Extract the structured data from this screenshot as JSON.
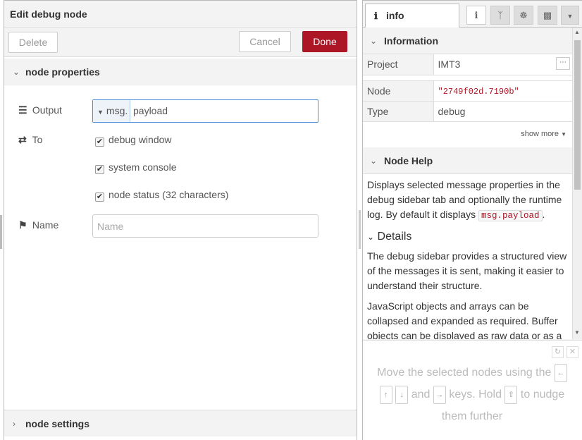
{
  "editor": {
    "title": "Edit debug node",
    "delete_label": "Delete",
    "cancel_label": "Cancel",
    "done_label": "Done",
    "section_properties": "node properties",
    "section_settings": "node settings",
    "output": {
      "label": "Output",
      "type_label": "msg.",
      "value": "payload"
    },
    "to": {
      "label": "To"
    },
    "checkboxes": [
      {
        "label": "debug window",
        "checked": true
      },
      {
        "label": "system console",
        "checked": true
      },
      {
        "label": "node status (32 characters)",
        "checked": true
      }
    ],
    "name": {
      "label": "Name",
      "placeholder": "Name",
      "value": ""
    }
  },
  "sidebar": {
    "tab_label": "info",
    "tab_icons": [
      "info-icon",
      "branch-icon",
      "bug-icon",
      "chart-icon",
      "chevron-down-icon"
    ],
    "information_header": "Information",
    "rows": [
      {
        "key": "Project",
        "value": "IMT3"
      },
      {
        "key": "Node",
        "value": "\"2749f02d.7190b\""
      },
      {
        "key": "Type",
        "value": "debug"
      }
    ],
    "show_more": "show more",
    "help_header": "Node Help",
    "help_p1_a": "Displays selected message properties in the debug sidebar tab and optionally the runtime log. By default it displays ",
    "help_p1_code": "msg.payload",
    "help_p1_b": ".",
    "details_header": "Details",
    "help_p2": "The debug sidebar provides a structured view of the messages it is sent, making it easier to understand their structure.",
    "help_p3": "JavaScript objects and arrays can be collapsed and expanded as required. Buffer objects can be displayed as raw data or as a string if possible."
  },
  "tips": {
    "part1": "Move the selected nodes using the",
    "part2": "and",
    "part3": "keys. Hold",
    "part4": "to nudge them further",
    "keys": {
      "left": "←",
      "up": "↑",
      "down": "↓",
      "right": "→",
      "shift": "⇧"
    }
  },
  "colors": {
    "accent": "#AD1625",
    "focus": "#4a90d9"
  }
}
